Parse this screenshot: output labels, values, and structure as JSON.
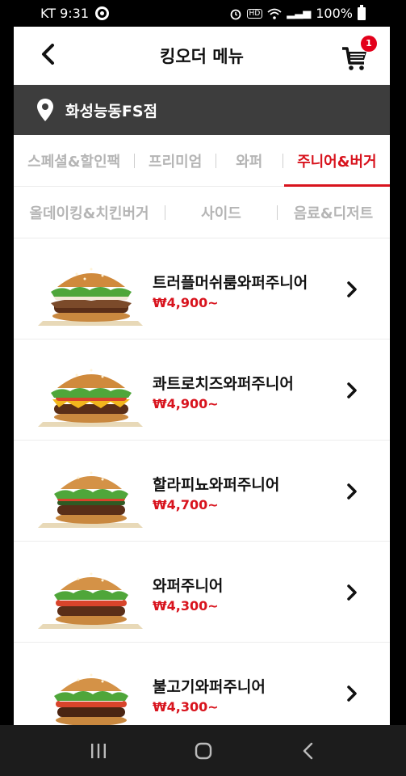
{
  "status_bar": {
    "carrier_time": "KT 9:31",
    "battery": "100%",
    "signal_glyph": "▂▃▅",
    "hd_label": "HD",
    "icons": [
      "target-icon",
      "alarm-icon",
      "hd-icon",
      "wifi-icon",
      "signal-icon",
      "battery-icon"
    ]
  },
  "header": {
    "title": "킹오더 메뉴",
    "cart_count": "1"
  },
  "store": {
    "name": "화성능동FS점"
  },
  "tabs_row1": [
    {
      "label": "스페셜&할인팩",
      "active": false
    },
    {
      "label": "프리미엄",
      "active": false
    },
    {
      "label": "와퍼",
      "active": false
    },
    {
      "label": "주니어&버거",
      "active": true
    }
  ],
  "tabs_row2": [
    {
      "label": "올데이킹&치킨버거",
      "active": false
    },
    {
      "label": "사이드",
      "active": false
    },
    {
      "label": "음료&디저트",
      "active": false
    }
  ],
  "menu_items": [
    {
      "name": "트러플머쉬룸와퍼주니어",
      "price": "₩4,900~"
    },
    {
      "name": "콰트로치즈와퍼주니어",
      "price": "₩4,900~"
    },
    {
      "name": "할라피뇨와퍼주니어",
      "price": "₩4,700~"
    },
    {
      "name": "와퍼주니어",
      "price": "₩4,300~"
    },
    {
      "name": "불고기와퍼주니어",
      "price": "₩4,300~"
    }
  ],
  "colors": {
    "accent": "#d8131d",
    "store_bar": "#3d3d3d",
    "nav_bar": "#1c1c1c"
  }
}
